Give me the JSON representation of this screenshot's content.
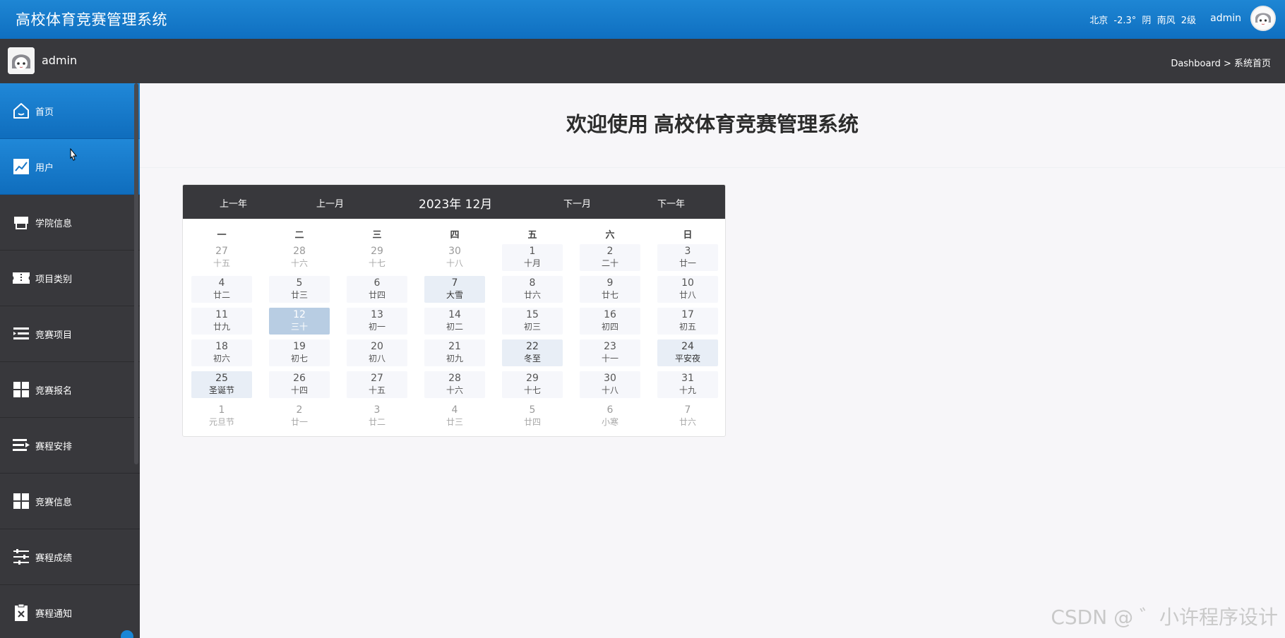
{
  "header": {
    "title": "高校体育竞赛管理系统",
    "weather": {
      "city": "北京",
      "temp": "-2.3°",
      "condition": "阴",
      "wind": "南风",
      "level": "2级"
    },
    "user": "admin",
    "avatar_icon": "anime-avatar-icon"
  },
  "subheader": {
    "user": "admin",
    "breadcrumb": "Dashboard > 系统首页"
  },
  "sidebar": {
    "items": [
      {
        "label": "首页",
        "icon": "home-icon",
        "active": true
      },
      {
        "label": "用户",
        "icon": "chart-line-icon",
        "active": true
      },
      {
        "label": "学院信息",
        "icon": "store-icon",
        "active": false
      },
      {
        "label": "项目类别",
        "icon": "ticket-icon",
        "active": false
      },
      {
        "label": "竞赛项目",
        "icon": "indent-list-icon",
        "active": false
      },
      {
        "label": "竞赛报名",
        "icon": "grid-icon",
        "active": false
      },
      {
        "label": "赛程安排",
        "icon": "list-arrow-icon",
        "active": false
      },
      {
        "label": "竞赛信息",
        "icon": "grid-icon",
        "active": false
      },
      {
        "label": "赛程成绩",
        "icon": "sliders-icon",
        "active": false
      },
      {
        "label": "赛程通知",
        "icon": "clipboard-x-icon",
        "active": false
      }
    ]
  },
  "main": {
    "welcome_prefix": "欢迎使用",
    "welcome_system": "高校体育竞赛管理系统"
  },
  "calendar": {
    "prev_year": "上一年",
    "prev_month": "上一月",
    "title": "2023年 12月",
    "next_month": "下一月",
    "next_year": "下一年",
    "weekdays": [
      "一",
      "二",
      "三",
      "四",
      "五",
      "六",
      "日"
    ],
    "weeks": [
      [
        {
          "d": "27",
          "l": "十五",
          "t": "other"
        },
        {
          "d": "28",
          "l": "十六",
          "t": "other"
        },
        {
          "d": "29",
          "l": "十七",
          "t": "other"
        },
        {
          "d": "30",
          "l": "十八",
          "t": "other"
        },
        {
          "d": "1",
          "l": "十月",
          "t": "cur"
        },
        {
          "d": "2",
          "l": "二十",
          "t": "cur"
        },
        {
          "d": "3",
          "l": "廿一",
          "t": "cur"
        }
      ],
      [
        {
          "d": "4",
          "l": "廿二",
          "t": "cur"
        },
        {
          "d": "5",
          "l": "廿三",
          "t": "cur"
        },
        {
          "d": "6",
          "l": "廿四",
          "t": "cur"
        },
        {
          "d": "7",
          "l": "大雪",
          "t": "fest"
        },
        {
          "d": "8",
          "l": "廿六",
          "t": "cur"
        },
        {
          "d": "9",
          "l": "廿七",
          "t": "cur"
        },
        {
          "d": "10",
          "l": "廿八",
          "t": "cur"
        }
      ],
      [
        {
          "d": "11",
          "l": "廿九",
          "t": "cur"
        },
        {
          "d": "12",
          "l": "三十",
          "t": "today"
        },
        {
          "d": "13",
          "l": "初一",
          "t": "cur"
        },
        {
          "d": "14",
          "l": "初二",
          "t": "cur"
        },
        {
          "d": "15",
          "l": "初三",
          "t": "cur"
        },
        {
          "d": "16",
          "l": "初四",
          "t": "cur"
        },
        {
          "d": "17",
          "l": "初五",
          "t": "cur"
        }
      ],
      [
        {
          "d": "18",
          "l": "初六",
          "t": "cur"
        },
        {
          "d": "19",
          "l": "初七",
          "t": "cur"
        },
        {
          "d": "20",
          "l": "初八",
          "t": "cur"
        },
        {
          "d": "21",
          "l": "初九",
          "t": "cur"
        },
        {
          "d": "22",
          "l": "冬至",
          "t": "fest"
        },
        {
          "d": "23",
          "l": "十一",
          "t": "cur"
        },
        {
          "d": "24",
          "l": "平安夜",
          "t": "fest"
        }
      ],
      [
        {
          "d": "25",
          "l": "圣诞节",
          "t": "fest"
        },
        {
          "d": "26",
          "l": "十四",
          "t": "cur"
        },
        {
          "d": "27",
          "l": "十五",
          "t": "cur"
        },
        {
          "d": "28",
          "l": "十六",
          "t": "cur"
        },
        {
          "d": "29",
          "l": "十七",
          "t": "cur"
        },
        {
          "d": "30",
          "l": "十八",
          "t": "cur"
        },
        {
          "d": "31",
          "l": "十九",
          "t": "cur"
        }
      ],
      [
        {
          "d": "1",
          "l": "元旦节",
          "t": "other"
        },
        {
          "d": "2",
          "l": "廿一",
          "t": "other"
        },
        {
          "d": "3",
          "l": "廿二",
          "t": "other"
        },
        {
          "d": "4",
          "l": "廿三",
          "t": "other"
        },
        {
          "d": "5",
          "l": "廿四",
          "t": "other"
        },
        {
          "d": "6",
          "l": "小寒",
          "t": "other"
        },
        {
          "d": "7",
          "l": "廿六",
          "t": "other"
        }
      ]
    ]
  },
  "watermark": "CSDN @ ゛小许程序设计",
  "colors": {
    "accent": "#1a86d6",
    "dark": "#38383c",
    "today": "#b8cde3"
  }
}
